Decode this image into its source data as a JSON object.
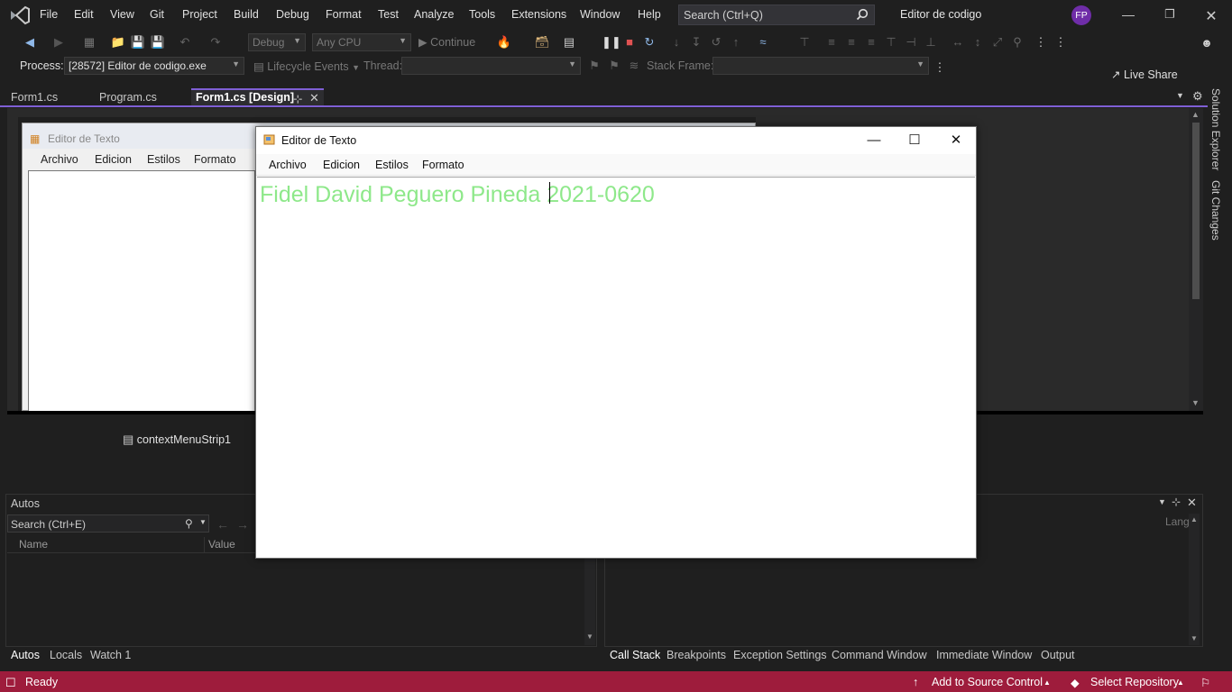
{
  "titlebar": {
    "menu": [
      "File",
      "Edit",
      "View",
      "Git",
      "Project",
      "Build",
      "Debug",
      "Format",
      "Test",
      "Analyze",
      "Tools",
      "Extensions",
      "Window",
      "Help"
    ],
    "search_placeholder": "Search (Ctrl+Q)",
    "app_title": "Editor de codigo",
    "avatar_initials": "FP"
  },
  "toolbar": {
    "config": "Debug",
    "platform": "Any CPU",
    "continue_label": "Continue",
    "live_share": "Live Share",
    "process_label": "Process:",
    "process_value": "[28572] Editor de codigo.exe",
    "lifecycle_label": "Lifecycle Events",
    "thread_label": "Thread:",
    "stack_frame_label": "Stack Frame:"
  },
  "tabs": [
    {
      "label": "Form1.cs"
    },
    {
      "label": "Program.cs"
    },
    {
      "label": "Form1.cs [Design]"
    }
  ],
  "designer": {
    "form_title": "Editor de Texto",
    "menu": [
      "Archivo",
      "Edicion",
      "Estilos",
      "Formato"
    ],
    "tray_item": "contextMenuStrip1"
  },
  "side_tabs": [
    "Solution Explorer",
    "Git Changes"
  ],
  "autos": {
    "title": "Autos",
    "search_placeholder": "Search (Ctrl+E)",
    "col_name": "Name",
    "col_value": "Value",
    "right_col": "Lang"
  },
  "bottom_tabs_left": [
    "Autos",
    "Locals",
    "Watch 1"
  ],
  "bottom_tabs_right": [
    "Call Stack",
    "Breakpoints",
    "Exception Settings",
    "Command Window",
    "Immediate Window",
    "Output"
  ],
  "status": {
    "ready": "Ready",
    "add_source": "Add to Source Control",
    "select_repo": "Select Repository"
  },
  "run_window": {
    "title": "Editor de Texto",
    "menu": [
      "Archivo",
      "Edicion",
      "Estilos",
      "Formato"
    ],
    "editor_text": "Fidel David Peguero Pineda 2021-0620",
    "text_color": "#8ee88a"
  },
  "colors": {
    "accent": "#7f5fd5",
    "statusbar": "#9e1c3c",
    "avatar": "#6f2da8"
  }
}
